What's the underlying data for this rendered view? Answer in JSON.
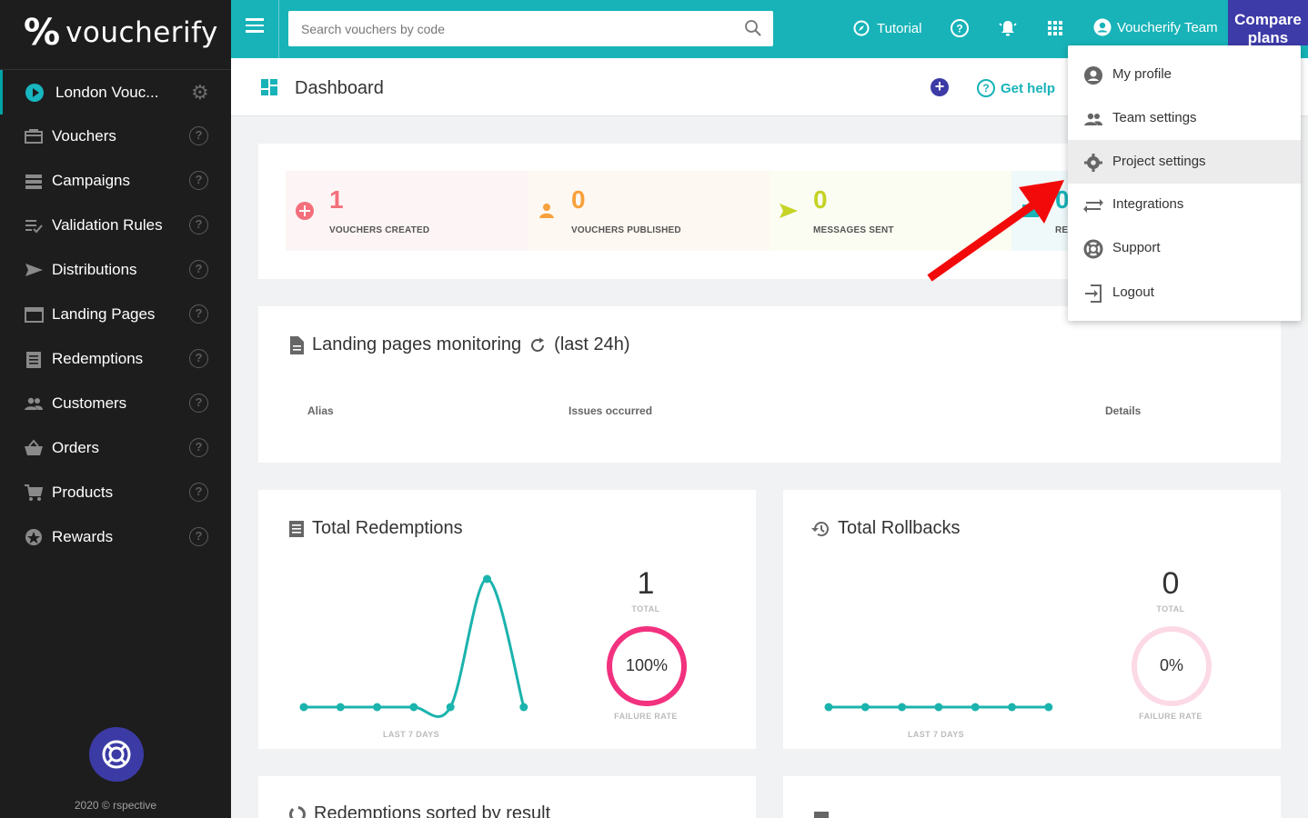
{
  "brand": {
    "name": "voucherify"
  },
  "sidebar": {
    "project": "London Vouc...",
    "items": [
      {
        "label": "Vouchers",
        "icon": "voucher-icon"
      },
      {
        "label": "Campaigns",
        "icon": "campaigns-icon"
      },
      {
        "label": "Validation Rules",
        "icon": "validation-rules-icon"
      },
      {
        "label": "Distributions",
        "icon": "send-icon"
      },
      {
        "label": "Landing Pages",
        "icon": "landing-page-icon"
      },
      {
        "label": "Redemptions",
        "icon": "receipt-icon"
      },
      {
        "label": "Customers",
        "icon": "people-icon"
      },
      {
        "label": "Orders",
        "icon": "basket-icon"
      },
      {
        "label": "Products",
        "icon": "cart-icon"
      },
      {
        "label": "Rewards",
        "icon": "star-icon"
      }
    ],
    "help_glyph": "?",
    "copyright": "2020 © rspective"
  },
  "topbar": {
    "search_placeholder": "Search vouchers by code",
    "tutorial": "Tutorial",
    "user": "Voucherify Team",
    "compare_line1": "Compare",
    "compare_line2": "plans"
  },
  "header": {
    "title": "Dashboard",
    "add_glyph": "+",
    "get_help": "Get help"
  },
  "stats": [
    {
      "value": "1",
      "caption": "VOUCHERS CREATED",
      "color": "#f36f7b",
      "bg": "#fdf5f5"
    },
    {
      "value": "0",
      "caption": "VOUCHERS PUBLISHED",
      "color": "#f7a13c",
      "bg": "#fdf8f2"
    },
    {
      "value": "0",
      "caption": "MESSAGES SENT",
      "color": "#c5d326",
      "bg": "#fbfcf2"
    },
    {
      "value": "0",
      "caption": "RE",
      "color": "#17b3b8",
      "bg": "#eff9fa"
    }
  ],
  "landing_monitoring": {
    "title": "Landing pages monitoring",
    "suffix": "(last 24h)",
    "columns": [
      "Alias",
      "Issues occurred",
      "Details"
    ]
  },
  "redemptions_card": {
    "title": "Total Redemptions",
    "total": "1",
    "total_label": "TOTAL",
    "rate": "100%",
    "rate_label": "FAILURE RATE",
    "x_label": "LAST 7 DAYS",
    "series": [
      0,
      0,
      0,
      0,
      0,
      1,
      0
    ],
    "ring_fraction": 1.0
  },
  "rollbacks_card": {
    "title": "Total Rollbacks",
    "total": "0",
    "total_label": "TOTAL",
    "rate": "0%",
    "rate_label": "FAILURE RATE",
    "x_label": "LAST 7 DAYS",
    "series": [
      0,
      0,
      0,
      0,
      0,
      0,
      0
    ],
    "ring_fraction": 0.0
  },
  "bottom_cards": {
    "left_title": "Redemptions sorted by result"
  },
  "dropdown": {
    "items": [
      {
        "label": "My profile",
        "icon": "account-circle-icon"
      },
      {
        "label": "Team settings",
        "icon": "team-icon"
      },
      {
        "label": "Project settings",
        "icon": "gear-icon"
      },
      {
        "label": "Integrations",
        "icon": "swap-arrows-icon"
      },
      {
        "label": "Support",
        "icon": "lifebuoy-icon"
      },
      {
        "label": "Logout",
        "icon": "logout-icon"
      }
    ],
    "active_index": 2
  },
  "colors": {
    "accent": "#17b3b8",
    "brand_purple": "#3c3ba5",
    "line": "#1bb3ad",
    "ring_active": "#f2317f",
    "ring_empty": "#fcd9e6",
    "annotation_arrow": "#f20a0a"
  }
}
